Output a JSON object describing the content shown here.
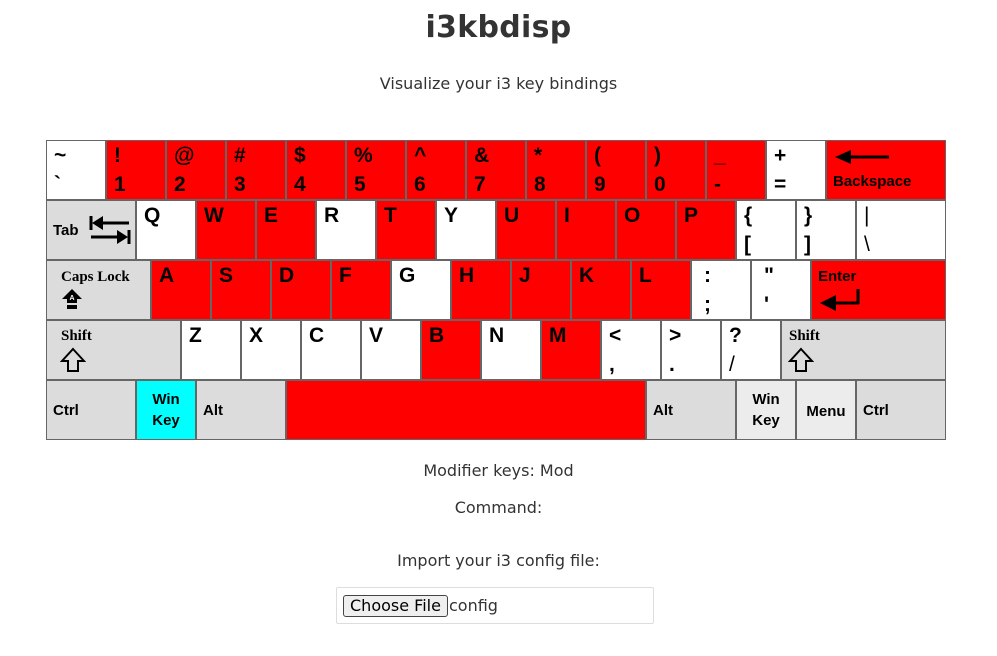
{
  "page": {
    "title": "i3kbdisp",
    "subtitle": "Visualize your i3 key bindings"
  },
  "colors": {
    "bound": "#ff0000",
    "modifier_active": "#00ffff",
    "unbound": "#ffffff",
    "modifier": "#dcdcdc"
  },
  "keyboard": {
    "row1": [
      {
        "top": "~",
        "bot": "`"
      },
      {
        "top": "!",
        "bot": "1"
      },
      {
        "top": "@",
        "bot": "2"
      },
      {
        "top": "#",
        "bot": "3"
      },
      {
        "top": "$",
        "bot": "4"
      },
      {
        "top": "%",
        "bot": "5"
      },
      {
        "top": "^",
        "bot": "6"
      },
      {
        "top": "&",
        "bot": "7"
      },
      {
        "top": "*",
        "bot": "8"
      },
      {
        "top": "(",
        "bot": "9"
      },
      {
        "top": ")",
        "bot": "0"
      },
      {
        "top": "_",
        "bot": "-"
      },
      {
        "top": "+",
        "bot": "="
      }
    ],
    "backspace": "Backspace",
    "tab": "Tab",
    "row2": [
      "Q",
      "W",
      "E",
      "R",
      "T",
      "Y",
      "U",
      "I",
      "O",
      "P"
    ],
    "row2_sym": [
      {
        "top": "{",
        "bot": "["
      },
      {
        "top": "}",
        "bot": "]"
      },
      {
        "top": "|",
        "bot": "\\"
      }
    ],
    "caps": "Caps Lock",
    "row3": [
      "A",
      "S",
      "D",
      "F",
      "G",
      "H",
      "J",
      "K",
      "L"
    ],
    "row3_sym": [
      {
        "top": ":",
        "bot": ";"
      },
      {
        "top": "\"",
        "bot": "'"
      }
    ],
    "enter": "Enter",
    "shift_left": "Shift",
    "row4": [
      "Z",
      "X",
      "C",
      "V",
      "B",
      "N",
      "M"
    ],
    "row4_sym": [
      {
        "top": "<",
        "bot": ","
      },
      {
        "top": ">",
        "bot": "."
      },
      {
        "top": "?",
        "bot": "/"
      }
    ],
    "shift_right": "Shift",
    "ctrl_left": "Ctrl",
    "win_left": {
      "line1": "Win",
      "line2": "Key"
    },
    "alt_left": "Alt",
    "alt_right": "Alt",
    "win_right": {
      "line1": "Win",
      "line2": "Key"
    },
    "menu": "Menu",
    "ctrl_right": "Ctrl"
  },
  "info": {
    "modifiers": "Modifier keys: Mod",
    "command": "Command:"
  },
  "import": {
    "label": "Import your i3 config file:",
    "button": "Choose File",
    "filename": "config"
  }
}
